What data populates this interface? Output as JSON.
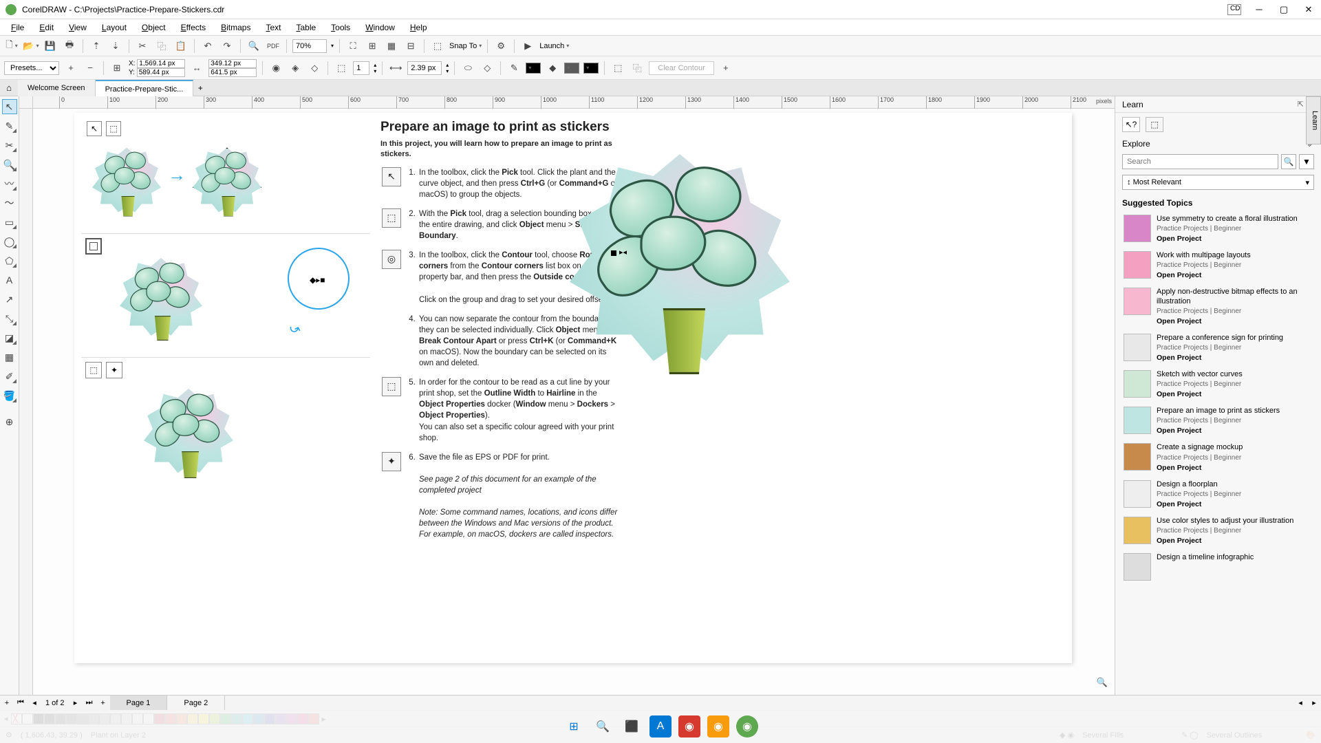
{
  "titlebar": {
    "app": "CorelDRAW",
    "file": "C:\\Projects\\Practice-Prepare-Stickers.cdr"
  },
  "menu": [
    "File",
    "Edit",
    "View",
    "Layout",
    "Object",
    "Effects",
    "Bitmaps",
    "Text",
    "Table",
    "Tools",
    "Window",
    "Help"
  ],
  "toolbar1": {
    "zoom": "70%",
    "snapto": "Snap To",
    "launch": "Launch"
  },
  "property": {
    "presets": "Presets...",
    "x": "1,569.14 px",
    "y": "589.44 px",
    "w": "349.12 px",
    "h": "641.5 px",
    "copies": "1",
    "outline": "2.39 px",
    "clear": "Clear Contour"
  },
  "doctabs": {
    "welcome": "Welcome Screen",
    "active": "Practice-Prepare-Stic..."
  },
  "ruler": {
    "ticks": [
      "0",
      "100",
      "200",
      "300",
      "400",
      "500",
      "600",
      "700",
      "800",
      "900",
      "1000",
      "1100",
      "1200",
      "1300",
      "1400",
      "1500",
      "1600",
      "1700",
      "1800",
      "1900",
      "2000",
      "2100"
    ],
    "unit": "pixels"
  },
  "instructions": {
    "title": "Prepare an image to print as stickers",
    "intro": "In this project, you will learn how to prepare an image to print as stickers.",
    "steps": [
      {
        "icon": "↖",
        "html": "In the toolbox, click the <b>Pick</b> tool. Click the plant and the curve object, and then press <b>Ctrl+G</b> (or <b>Command+G</b> on macOS) to group the objects."
      },
      {
        "icon": "⬚",
        "html": "With the <b>Pick</b> tool, drag a selection bounding box around the entire drawing, and click <b>Object</b> menu > <b>Shaping</b> > <b>Boundary</b>."
      },
      {
        "icon": "◎",
        "html": "In the toolbox, click the <b>Contour</b> tool, choose <b>Round corners</b> from the <b>Contour corners</b> list box on the property bar, and then press the <b>Outside contour</b> button.<br><br>Click on the group and drag to set your desired offset."
      },
      {
        "icon": "",
        "html": "You can now separate the contour from the boundary so they can be selected individually. Click <b>Object</b> menu > <b>Break Contour Apart</b> or press <b>Ctrl+K</b> (or <b>Command+K</b> on macOS). Now the boundary can be selected on its own and deleted."
      },
      {
        "icon": "⬚",
        "html": "In order for the contour to be read as a cut line by your print shop, set the <b>Outline Width</b> to <b>Hairline</b> in the <b>Object Properties</b> docker (<b>Window</b> menu > <b>Dockers</b> > <b>Object Properties</b>).<br>You can also set a specific colour agreed with your print shop."
      },
      {
        "icon": "✦",
        "html": "Save the file as EPS or PDF for print.<br><br><em>See page 2 of this document for an example of the completed project</em><br><br><em>Note: Some command names, locations, and icons differ between the Windows and Mac versions of the product. For example, on macOS, dockers are called inspectors.</em>"
      }
    ]
  },
  "learn": {
    "title": "Learn",
    "explore": "Explore",
    "search_ph": "Search",
    "sort": "Most Relevant",
    "heading": "Suggested Topics",
    "topics": [
      {
        "title": "Use symmetry to create a floral illustration",
        "meta": "Practice Projects | Beginner",
        "open": "Open Project",
        "thumb": "#d986c8"
      },
      {
        "title": "Work with multipage layouts",
        "meta": "Practice Projects | Beginner",
        "open": "Open Project",
        "thumb": "#f4a0c0"
      },
      {
        "title": "Apply non-destructive bitmap effects to an illustration",
        "meta": "Practice Projects | Beginner",
        "open": "Open Project",
        "thumb": "#f6b7cf"
      },
      {
        "title": "Prepare a conference sign for printing",
        "meta": "Practice Projects | Beginner",
        "open": "Open Project",
        "thumb": "#e8e8e8"
      },
      {
        "title": "Sketch with vector curves",
        "meta": "Practice Projects | Beginner",
        "open": "Open Project",
        "thumb": "#cfe8d5"
      },
      {
        "title": "Prepare an image to print as stickers",
        "meta": "Practice Projects | Beginner",
        "open": "Open Project",
        "thumb": "#bfe5e2"
      },
      {
        "title": "Create a signage mockup",
        "meta": "Practice Projects | Beginner",
        "open": "Open Project",
        "thumb": "#c88a4a"
      },
      {
        "title": "Design a floorplan",
        "meta": "Practice Projects | Beginner",
        "open": "Open Project",
        "thumb": "#eee"
      },
      {
        "title": "Use color styles to adjust your illustration",
        "meta": "Practice Projects | Beginner",
        "open": "Open Project",
        "thumb": "#e8c060"
      },
      {
        "title": "Design a timeline infographic",
        "meta": "",
        "open": "",
        "thumb": "#ddd"
      }
    ]
  },
  "pagenav": {
    "counter": "1 of 2",
    "pages": [
      "Page 1",
      "Page 2"
    ]
  },
  "palette": [
    "#ffffff",
    "#000000",
    "#1a1a1a",
    "#333333",
    "#4d4d4d",
    "#666666",
    "#808080",
    "#999999",
    "#b3b3b3",
    "#cccccc",
    "#e6e6e6",
    "#f2f2f2",
    "#c8102e",
    "#ef3340",
    "#ff6720",
    "#ffc72c",
    "#fce300",
    "#97d700",
    "#00b140",
    "#00a499",
    "#00b5e2",
    "#0077c8",
    "#1e22aa",
    "#753bbd",
    "#c724b1",
    "#e31c79",
    "#ef3340"
  ],
  "status": {
    "coords": "( 1,606.43, 39.29 )",
    "layer": "Plant on Layer 2",
    "fills": "Several Fills",
    "outlines": "Several Outlines"
  },
  "sidetab": "Learn"
}
